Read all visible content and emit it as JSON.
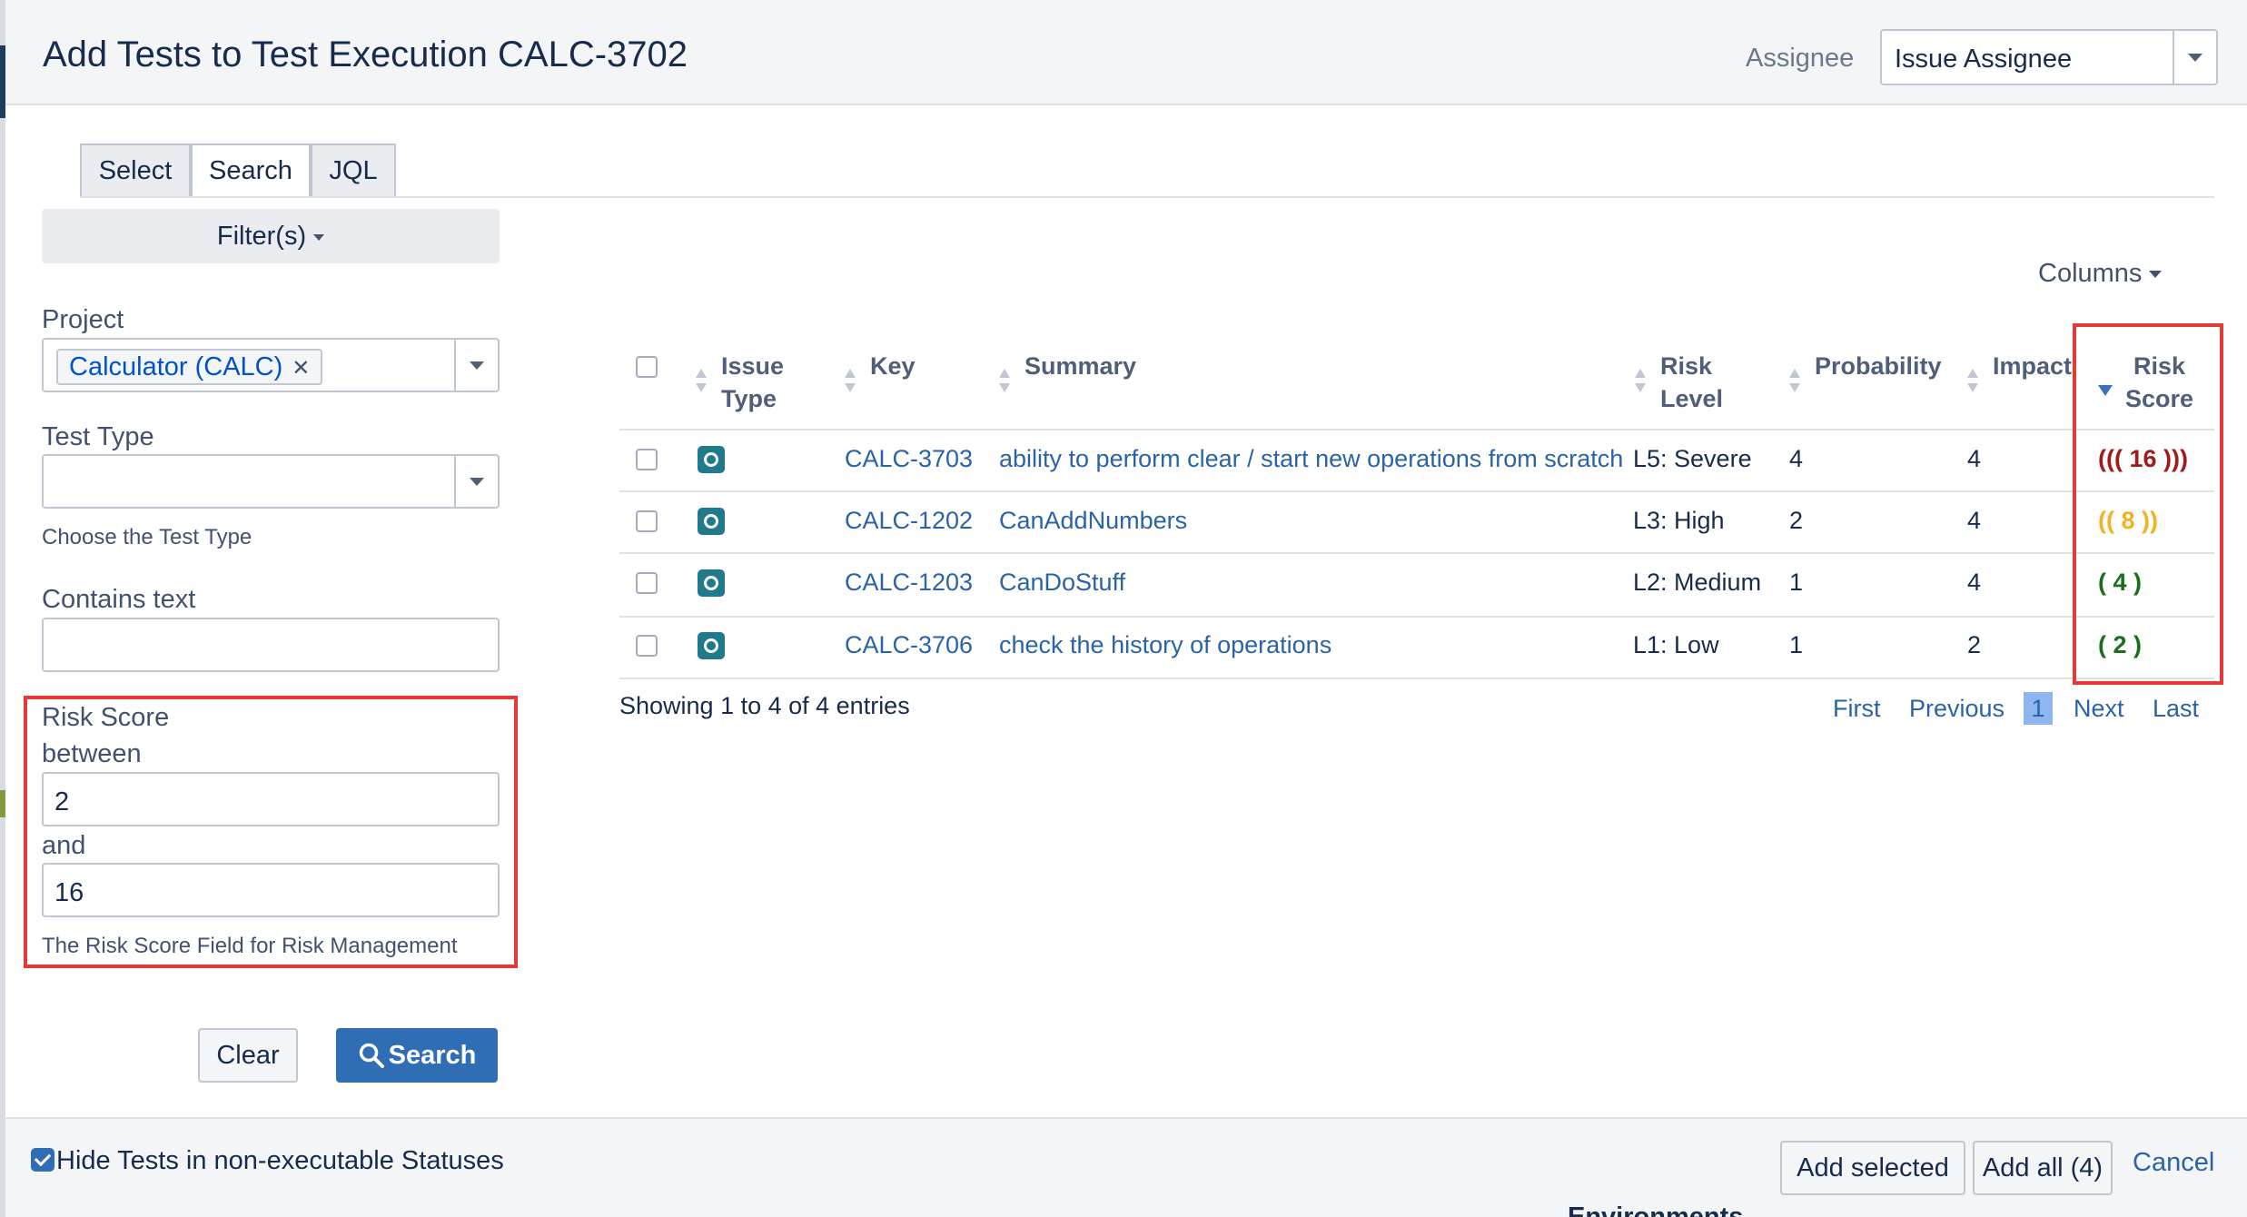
{
  "dialog": {
    "title": "Add Tests to Test Execution CALC-3702",
    "assignee_label": "Assignee",
    "assignee_value": "Issue Assignee"
  },
  "tabs": [
    {
      "label": "Select",
      "active": false
    },
    {
      "label": "Search",
      "active": true
    },
    {
      "label": "JQL",
      "active": false
    }
  ],
  "filters": {
    "toggle_label": "Filter(s)",
    "project_label": "Project",
    "project_value": "Calculator (CALC)",
    "test_type_label": "Test Type",
    "test_type_help": "Choose the Test Type",
    "contains_label": "Contains text",
    "contains_value": "",
    "risk_label": "Risk Score",
    "between_label": "between",
    "risk_min": "2",
    "and_label": "and",
    "risk_max": "16",
    "risk_help": "The Risk Score Field for Risk Management",
    "clear_label": "Clear",
    "search_label": "Search"
  },
  "table": {
    "columns_label": "Columns",
    "headers": {
      "issue_type_1": "Issue",
      "issue_type_2": "Type",
      "key": "Key",
      "summary": "Summary",
      "risk_level_1": "Risk",
      "risk_level_2": "Level",
      "probability": "Probability",
      "impact": "Impact",
      "risk_score_1": "Risk",
      "risk_score_2": "Score"
    },
    "rows": [
      {
        "key": "CALC-3703",
        "summary": "ability to perform clear / start new operations from scratch",
        "risk_level": "L5: Severe",
        "probability": "4",
        "impact": "4",
        "risk_score": "((( 16 )))",
        "risk_color": "#a11b1b"
      },
      {
        "key": "CALC-1202",
        "summary": "CanAddNumbers",
        "risk_level": "L3: High",
        "probability": "2",
        "impact": "4",
        "risk_score": "(( 8 ))",
        "risk_color": "#f0b323"
      },
      {
        "key": "CALC-1203",
        "summary": "CanDoStuff",
        "risk_level": "L2: Medium",
        "probability": "1",
        "impact": "4",
        "risk_score": "( 4 )",
        "risk_color": "#1b6e1b"
      },
      {
        "key": "CALC-3706",
        "summary": "check the history of operations",
        "risk_level": "L1: Low",
        "probability": "1",
        "impact": "2",
        "risk_score": "( 2 )",
        "risk_color": "#1b6e1b"
      }
    ],
    "showing": "Showing 1 to 4 of 4 entries",
    "pager": {
      "first": "First",
      "previous": "Previous",
      "current": "1",
      "next": "Next",
      "last": "Last"
    }
  },
  "footer": {
    "hide_label": "Hide Tests in non-executable Statuses",
    "hide_checked": true,
    "add_selected": "Add selected",
    "add_all": "Add all (4)",
    "cancel": "Cancel",
    "peek_text": "Environments"
  },
  "colors": {
    "highlight": "#e53935",
    "primary": "#2f6db5",
    "link": "#2a63a8"
  }
}
